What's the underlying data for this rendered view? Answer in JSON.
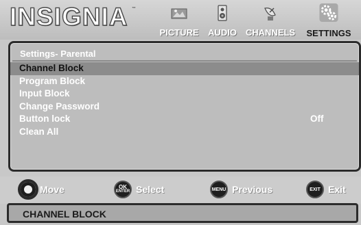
{
  "header": {
    "logo": "INSIGNIA",
    "trademark": "™",
    "tabs": [
      {
        "label": "PICTURE",
        "icon": "picture-icon",
        "active": false
      },
      {
        "label": "AUDIO",
        "icon": "speaker-icon",
        "active": false
      },
      {
        "label": "CHANNELS",
        "icon": "satellite-dish-icon",
        "active": false
      },
      {
        "label": "SETTINGS",
        "icon": "gears-icon",
        "active": true
      }
    ]
  },
  "panel": {
    "title": "Settings- Parental",
    "items": [
      {
        "label": "Channel Block",
        "selected": true,
        "value": ""
      },
      {
        "label": "Program Block",
        "selected": false,
        "value": ""
      },
      {
        "label": "Input Block",
        "selected": false,
        "value": ""
      },
      {
        "label": "Change Password",
        "selected": false,
        "value": ""
      },
      {
        "label": "Button lock",
        "selected": false,
        "value": "Off"
      },
      {
        "label": "Clean All",
        "selected": false,
        "value": ""
      }
    ]
  },
  "controls": {
    "move": {
      "label": "Move",
      "icon": "dpad-icon"
    },
    "select": {
      "label": "Select",
      "button_top": "OK",
      "button_bottom": "ENTER"
    },
    "previous": {
      "label": "Previous",
      "button": "MENU"
    },
    "exit": {
      "label": "Exit",
      "button": "EXIT"
    }
  },
  "status": {
    "text": "CHANNEL BLOCK"
  }
}
